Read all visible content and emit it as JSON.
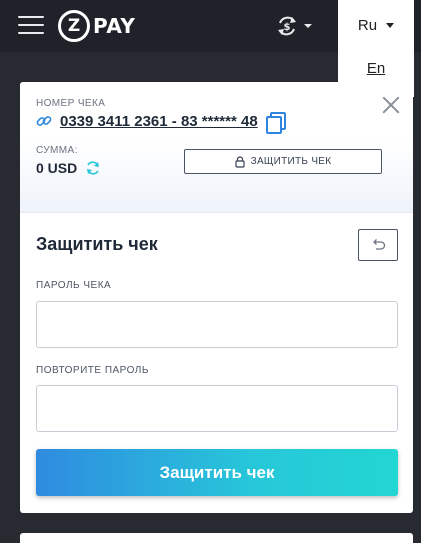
{
  "header": {
    "logo_letter": "Z",
    "logo_text": "PAY",
    "currency_icon": "currency-exchange-icon",
    "language": {
      "current": "Ru",
      "options": [
        "En"
      ]
    }
  },
  "check": {
    "number_label": "НОМЕР ЧЕКА",
    "number": "0339 3411 2361 - 83 ****** 48",
    "amount_label": "СУММА:",
    "amount": "0 USD",
    "protect_label": "ЗАЩИТИТЬ ЧЕК"
  },
  "form": {
    "title": "Защитить чек",
    "password_label": "ПАРОЛЬ ЧЕКА",
    "password_value": "",
    "repeat_label": "ПОВТОРИТЕ ПАРОЛЬ",
    "repeat_value": "",
    "submit_label": "Защитить чек"
  },
  "colors": {
    "header_bg": "#1f2329",
    "page_bg": "#272b31",
    "accent_blue": "#2e86de",
    "accent_cyan": "#22d6d3"
  }
}
